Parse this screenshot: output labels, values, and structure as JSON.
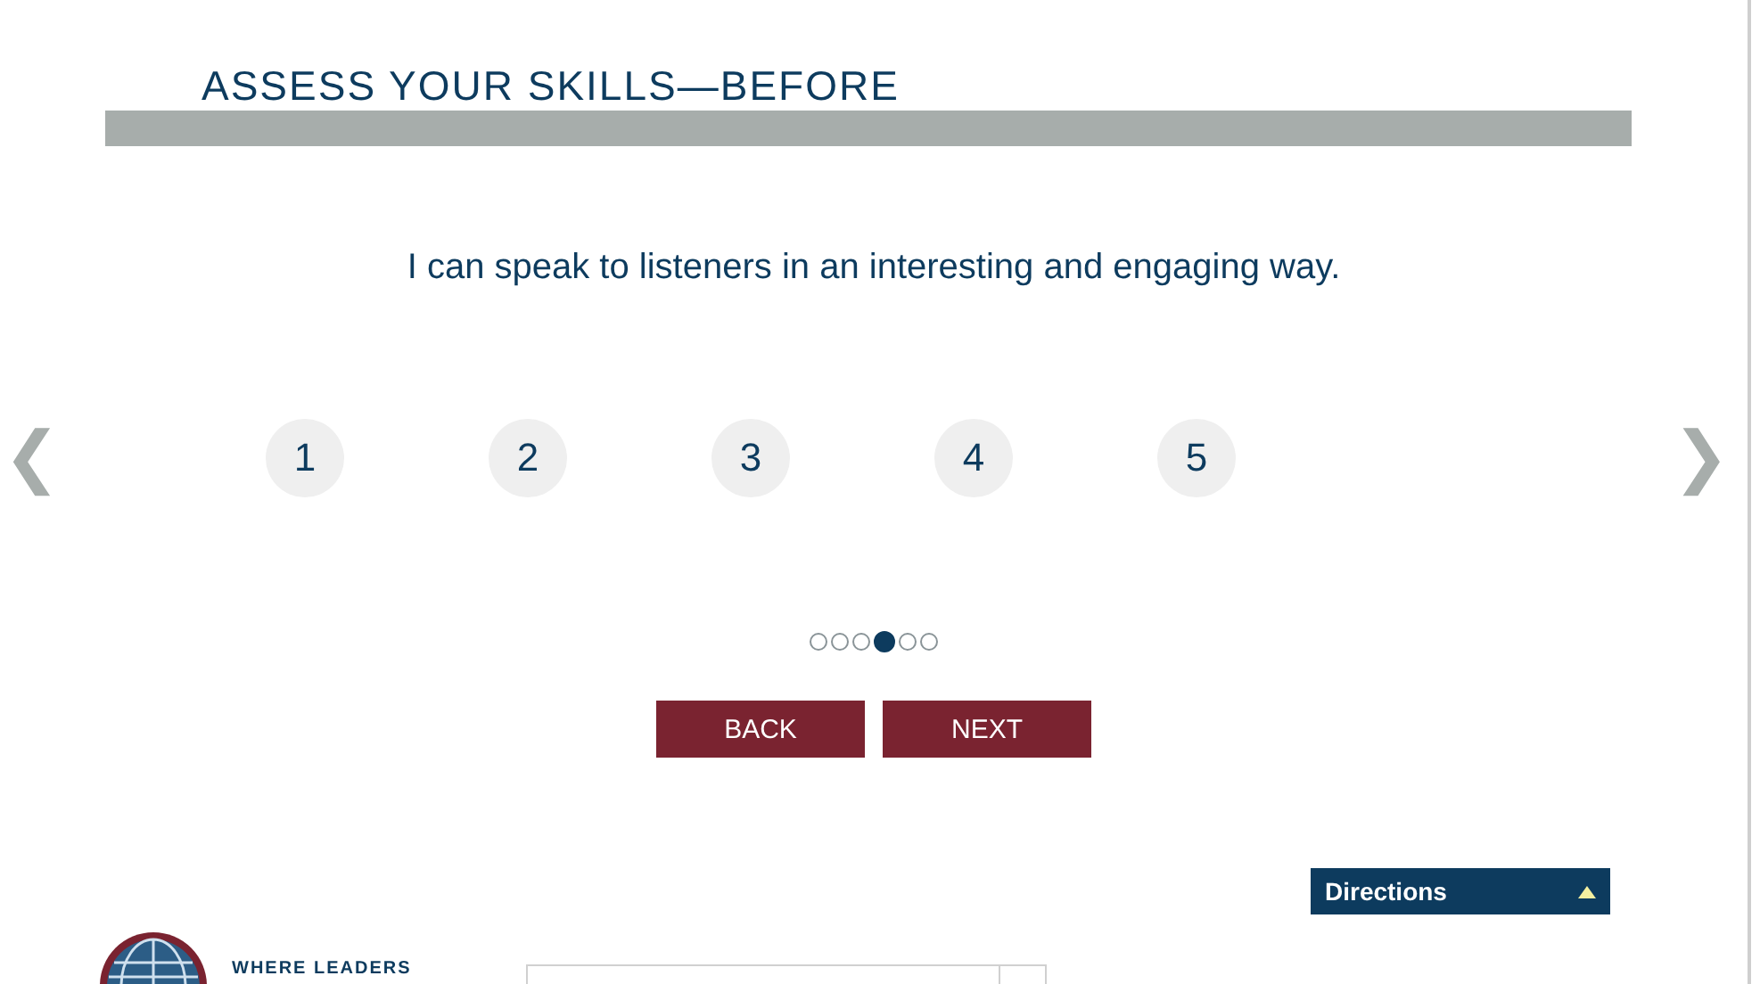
{
  "header": {
    "title": "ASSESS YOUR SKILLS—BEFORE"
  },
  "question": "I can speak to listeners in an interesting and engaging way.",
  "nav": {
    "previous": "❮",
    "next": "❯"
  },
  "ratings": [
    {
      "label": "1",
      "selected": false
    },
    {
      "label": "2",
      "selected": false
    },
    {
      "label": "3",
      "selected": false
    },
    {
      "label": "4",
      "selected": false
    },
    {
      "label": "5",
      "selected": false
    }
  ],
  "progress_dots": [
    {
      "selected": false
    },
    {
      "selected": false
    },
    {
      "selected": false
    },
    {
      "selected": true
    },
    {
      "selected": false
    },
    {
      "selected": false
    }
  ],
  "buttons": [
    "BACK",
    "NEXT"
  ],
  "directions": {
    "label": "Directions",
    "expanded": false
  },
  "footer": {
    "tagline": "WHERE LEADERS"
  }
}
